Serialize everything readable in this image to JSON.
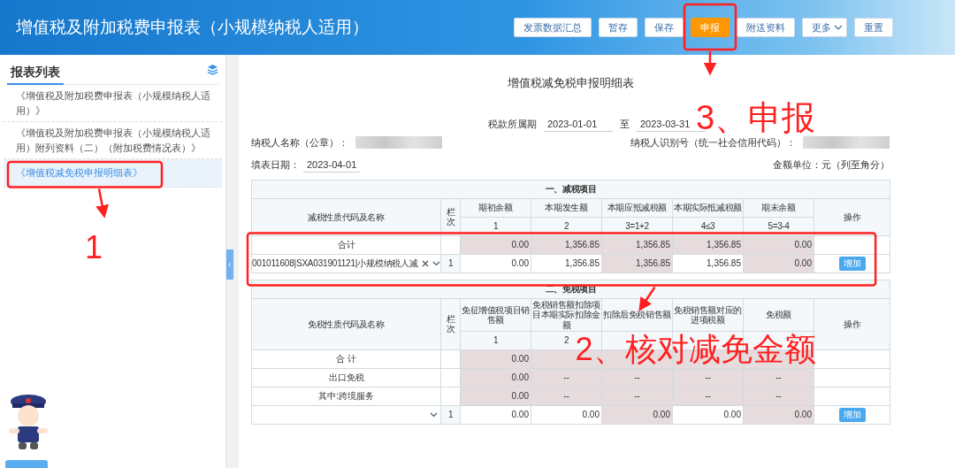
{
  "header": {
    "title": "增值税及附加税费申报表（小规模纳税人适用）",
    "buttons": [
      {
        "label": "发票数据汇总",
        "kind": "default"
      },
      {
        "label": "暂存",
        "kind": "default"
      },
      {
        "label": "保存",
        "kind": "default"
      },
      {
        "label": "申报",
        "kind": "primary"
      },
      {
        "label": "附送资料",
        "kind": "default"
      },
      {
        "label": "更多",
        "kind": "dropdown"
      },
      {
        "label": "重置",
        "kind": "default"
      }
    ]
  },
  "sidebar": {
    "title": "报表列表",
    "items": [
      {
        "label": "《增值税及附加税费申报表（小规模纳税人适用）》",
        "selected": false
      },
      {
        "label": "《增值税及附加税费申报表（小规模纳税人适用）附列资料（二）（附加税费情况表）》",
        "selected": false
      },
      {
        "label": "《增值税减免税申报明细表》",
        "selected": true
      }
    ],
    "collapse_handle": "‹"
  },
  "form": {
    "title": "增值税减免税申报明细表",
    "period_label": "税款所属期",
    "period_start": "2023-01-01",
    "period_separator": "至",
    "period_end": "2023-03-31",
    "taxpayer_name_label": "纳税人名称（公章）：",
    "taxpayer_id_label": "纳税人识别号（统一社会信用代码）：",
    "fill_date_label": "填表日期：",
    "fill_date": "2023-04-01",
    "unit": "金额单位：元（列至角分）"
  },
  "reduction_table": {
    "section_title": "一、减税项目",
    "name_header": "减税性质代码及名称",
    "line_header": "栏次",
    "action_header": "操作",
    "columns": [
      {
        "label": "期初余额",
        "number": "1"
      },
      {
        "label": "本期发生额",
        "number": "2"
      },
      {
        "label": "本期应抵减税额",
        "number": "3=1+2"
      },
      {
        "label": "本期实际抵减税额",
        "number": "4≤3"
      },
      {
        "label": "期末余额",
        "number": "5=3-4"
      }
    ],
    "rows": [
      {
        "kind": "total",
        "name": "合计",
        "cells": [
          {
            "text": "0.00",
            "readonly": true
          },
          {
            "text": "1,356.85",
            "readonly": true
          },
          {
            "text": "1,356.85",
            "readonly": true
          },
          {
            "text": "1,356.85",
            "readonly": true
          },
          {
            "text": "0.00",
            "readonly": true
          }
        ]
      },
      {
        "kind": "select",
        "name": "001011608|SXA031901121|小规模纳税人减",
        "clearable": true,
        "line": "1",
        "cells": [
          {
            "text": "0.00",
            "readonly": false
          },
          {
            "text": "1,356.85",
            "readonly": false
          },
          {
            "text": "1,356.85",
            "readonly": true
          },
          {
            "text": "1,356.85",
            "readonly": false
          },
          {
            "text": "0.00",
            "readonly": true
          }
        ],
        "action": "增加"
      }
    ]
  },
  "exemption_table": {
    "section_title": "二、免税项目",
    "name_header": "免税性质代码及名称",
    "line_header": "栏次",
    "action_header": "操作",
    "columns": [
      {
        "label": "免征增值税项目销售额",
        "number": "1"
      },
      {
        "label": "免税销售额扣除项目本期实际扣除金额",
        "number": "2"
      },
      {
        "label": "扣除后免税销售额"
      },
      {
        "label": "免税销售额对应的进项税额"
      },
      {
        "label": "免税额"
      }
    ],
    "rows": [
      {
        "kind": "total",
        "name": "合 计",
        "cells": [
          {
            "text": "0.00",
            "readonly": true
          },
          {
            "readonly": true
          },
          {
            "readonly": true
          },
          {
            "readonly": true
          },
          {
            "readonly": true
          }
        ]
      },
      {
        "kind": "fixed",
        "name": "出口免税",
        "cells": [
          {
            "text": "0.00",
            "readonly": true
          },
          {
            "text": "--",
            "readonly": true
          },
          {
            "text": "--",
            "readonly": true
          },
          {
            "text": "--",
            "readonly": true
          },
          {
            "text": "--",
            "readonly": true
          }
        ]
      },
      {
        "kind": "fixed",
        "name": "其中:跨境服务",
        "cells": [
          {
            "text": "0.00",
            "readonly": true
          },
          {
            "text": "--",
            "readonly": true
          },
          {
            "text": "--",
            "readonly": true
          },
          {
            "text": "--",
            "readonly": true
          },
          {
            "text": "--",
            "readonly": true
          }
        ]
      },
      {
        "kind": "select",
        "line": "1",
        "cells": [
          {
            "text": "0.00",
            "readonly": false
          },
          {
            "text": "0.00",
            "readonly": false
          },
          {
            "text": "0.00",
            "readonly": true
          },
          {
            "text": "0.00",
            "readonly": false
          },
          {
            "text": "0.00",
            "readonly": true
          }
        ],
        "action": "增加"
      }
    ]
  },
  "annotations": {
    "labels": [
      "3、申报",
      "1",
      "2、核对减免金额"
    ]
  }
}
